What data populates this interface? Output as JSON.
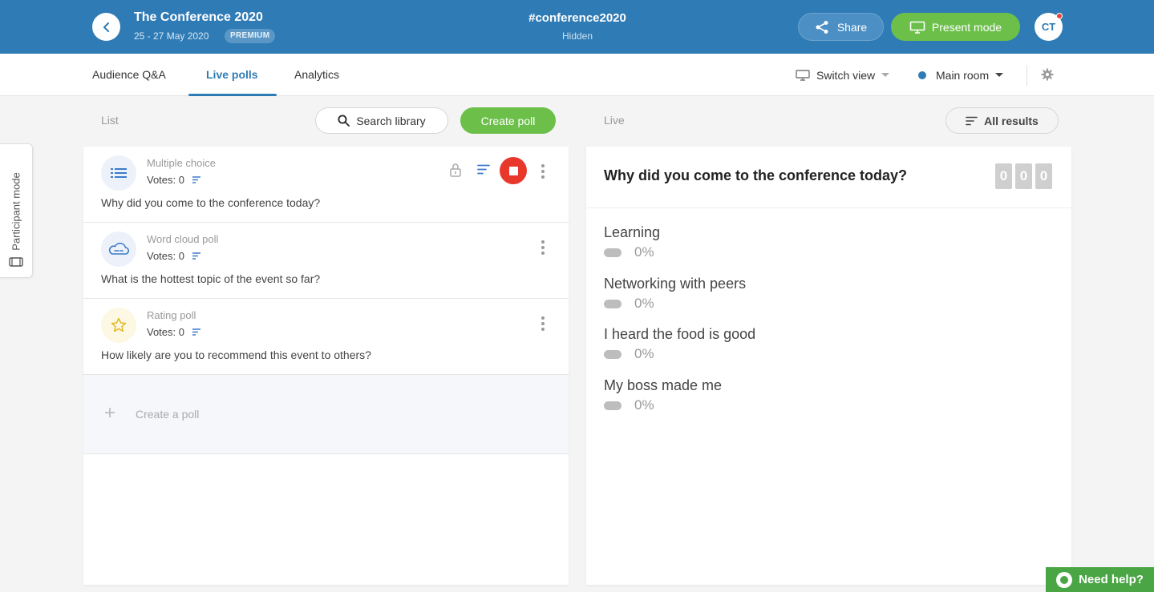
{
  "event": {
    "title": "The Conference 2020",
    "dates": "25 - 27 May 2020",
    "plan": "PREMIUM",
    "code": "#conference2020",
    "visibility": "Hidden"
  },
  "header": {
    "share_label": "Share",
    "present_label": "Present mode",
    "avatar_initials": "CT"
  },
  "nav": {
    "tabs": [
      {
        "label": "Audience Q&A"
      },
      {
        "label": "Live polls"
      },
      {
        "label": "Analytics"
      }
    ],
    "active_tab": "Live polls",
    "switch_view_label": "Switch view",
    "room_label": "Main room"
  },
  "toolbar": {
    "list_label": "List",
    "search_library_label": "Search library",
    "create_poll_label": "Create poll",
    "live_label": "Live",
    "all_results_label": "All results"
  },
  "participant_mode_label": "Participant mode",
  "polls": [
    {
      "type": "Multiple choice",
      "votes": "Votes: 0",
      "question": "Why did you come to the conference today?",
      "icon": "list-icon",
      "active": true
    },
    {
      "type": "Word cloud poll",
      "votes": "Votes: 0",
      "question": "What is the hottest topic of the event so far?",
      "icon": "cloud-icon",
      "active": false
    },
    {
      "type": "Rating poll",
      "votes": "Votes: 0",
      "question": "How likely are you to recommend this event to others?",
      "icon": "star-icon",
      "active": false
    }
  ],
  "create_a_poll_label": "Create a poll",
  "live_poll": {
    "question": "Why did you come to the conference today?",
    "vote_counter": [
      "0",
      "0",
      "0"
    ],
    "options": [
      {
        "label": "Learning",
        "percent": "0%"
      },
      {
        "label": "Networking with peers",
        "percent": "0%"
      },
      {
        "label": "I heard the food is good",
        "percent": "0%"
      },
      {
        "label": "My boss made me",
        "percent": "0%"
      }
    ]
  },
  "help_label": "Need help?",
  "colors": {
    "brand_blue": "#2f7bb5",
    "accent_green": "#6cc04a",
    "stop_red": "#e8372b",
    "help_green": "#4aa545"
  }
}
